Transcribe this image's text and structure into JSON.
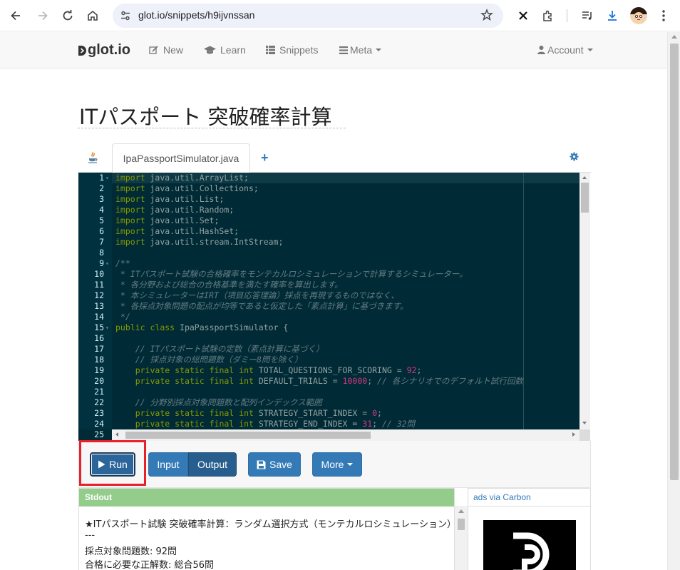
{
  "browser": {
    "url": "glot.io/snippets/h9ijvnssan"
  },
  "navbar": {
    "brand": "glot.io",
    "new_label": "New",
    "learn_label": "Learn",
    "snippets_label": "Snippets",
    "meta_label": "Meta",
    "account_label": "Account"
  },
  "snippet": {
    "title": "ITパスポート 突破確率計算",
    "file_tab": "IpaPassportSimulator.java"
  },
  "editor": {
    "lines": [
      {
        "n": "1",
        "html": "<span class='kw'>import</span> java.util.ArrayList;"
      },
      {
        "n": "2",
        "html": "<span class='kw'>import</span> java.util.Collections;"
      },
      {
        "n": "3",
        "html": "<span class='kw'>import</span> java.util.List;"
      },
      {
        "n": "4",
        "html": "<span class='kw'>import</span> java.util.Random;"
      },
      {
        "n": "5",
        "html": "<span class='kw'>import</span> java.util.Set;"
      },
      {
        "n": "6",
        "html": "<span class='kw'>import</span> java.util.HashSet;"
      },
      {
        "n": "7",
        "html": "<span class='kw'>import</span> java.util.stream.IntStream;"
      },
      {
        "n": "8",
        "html": ""
      },
      {
        "n": "9",
        "html": "<span class='cm'>/**</span>"
      },
      {
        "n": "10",
        "html": "<span class='cm'> * ITパスポート試験の合格確率をモンテカルロシミュレーションで計算するシミュレーター。</span>"
      },
      {
        "n": "11",
        "html": "<span class='cm'> * 各分野および総合の合格基準を満たす確率を算出します。</span>"
      },
      {
        "n": "12",
        "html": "<span class='cm'> * 本シミュレーターはIRT（項目応答理論）採点を再現するものではなく、</span>"
      },
      {
        "n": "13",
        "html": "<span class='cm'> * 各採点対象問題の配点が均等であると仮定した「素点計算」に基づきます。</span>"
      },
      {
        "n": "14",
        "html": "<span class='cm'> */</span>"
      },
      {
        "n": "15",
        "html": "<span class='kw'>public</span> <span class='kw'>class</span> IpaPassportSimulator {"
      },
      {
        "n": "16",
        "html": ""
      },
      {
        "n": "17",
        "html": "    <span class='cm'>// ITパスポート試験の定数（素点計算に基づく）</span>"
      },
      {
        "n": "18",
        "html": "    <span class='cm'>// 採点対象の総問題数（ダミー8問を除く）</span>"
      },
      {
        "n": "19",
        "html": "    <span class='kw'>private</span> <span class='kw'>static</span> <span class='kw'>final</span> <span class='kw'>int</span> TOTAL_QUESTIONS_FOR_SCORING = <span class='nm'>92</span>;"
      },
      {
        "n": "20",
        "html": "    <span class='kw'>private</span> <span class='kw'>static</span> <span class='kw'>final</span> <span class='kw'>int</span> DEFAULT_TRIALS = <span class='nm'>10000</span>; <span class='cm'>// 各シナリオでのデフォルト試行回数</span>"
      },
      {
        "n": "21",
        "html": ""
      },
      {
        "n": "22",
        "html": "    <span class='cm'>// 分野別採点対象問題数と配列インデックス範囲</span>"
      },
      {
        "n": "23",
        "html": "    <span class='kw'>private</span> <span class='kw'>static</span> <span class='kw'>final</span> <span class='kw'>int</span> STRATEGY_START_INDEX = <span class='nm'>0</span>;"
      },
      {
        "n": "24",
        "html": "    <span class='kw'>private</span> <span class='kw'>static</span> <span class='kw'>final</span> <span class='kw'>int</span> STRATEGY_END_INDEX = <span class='nm'>31</span>; <span class='cm'>// 32問</span>"
      },
      {
        "n": "25",
        "html": ""
      }
    ]
  },
  "toolbar": {
    "run_label": "Run",
    "input_label": "Input",
    "output_label": "Output",
    "save_label": "Save",
    "more_label": "More"
  },
  "output": {
    "header": "Stdout",
    "lines": [
      "★ITパスポート試験 突破確率計算：ランダム選択方式（モンテカルロシミュレーション）",
      "---",
      "採点対象問題数: 92問",
      "合格に必要な正解数: 総合56問"
    ]
  },
  "ads": {
    "header": "ads via Carbon"
  },
  "colors": {
    "accent": "#337ab7",
    "editor_bg": "#002b36",
    "stdout_header": "#93cc8b",
    "highlight": "#e8202a"
  }
}
